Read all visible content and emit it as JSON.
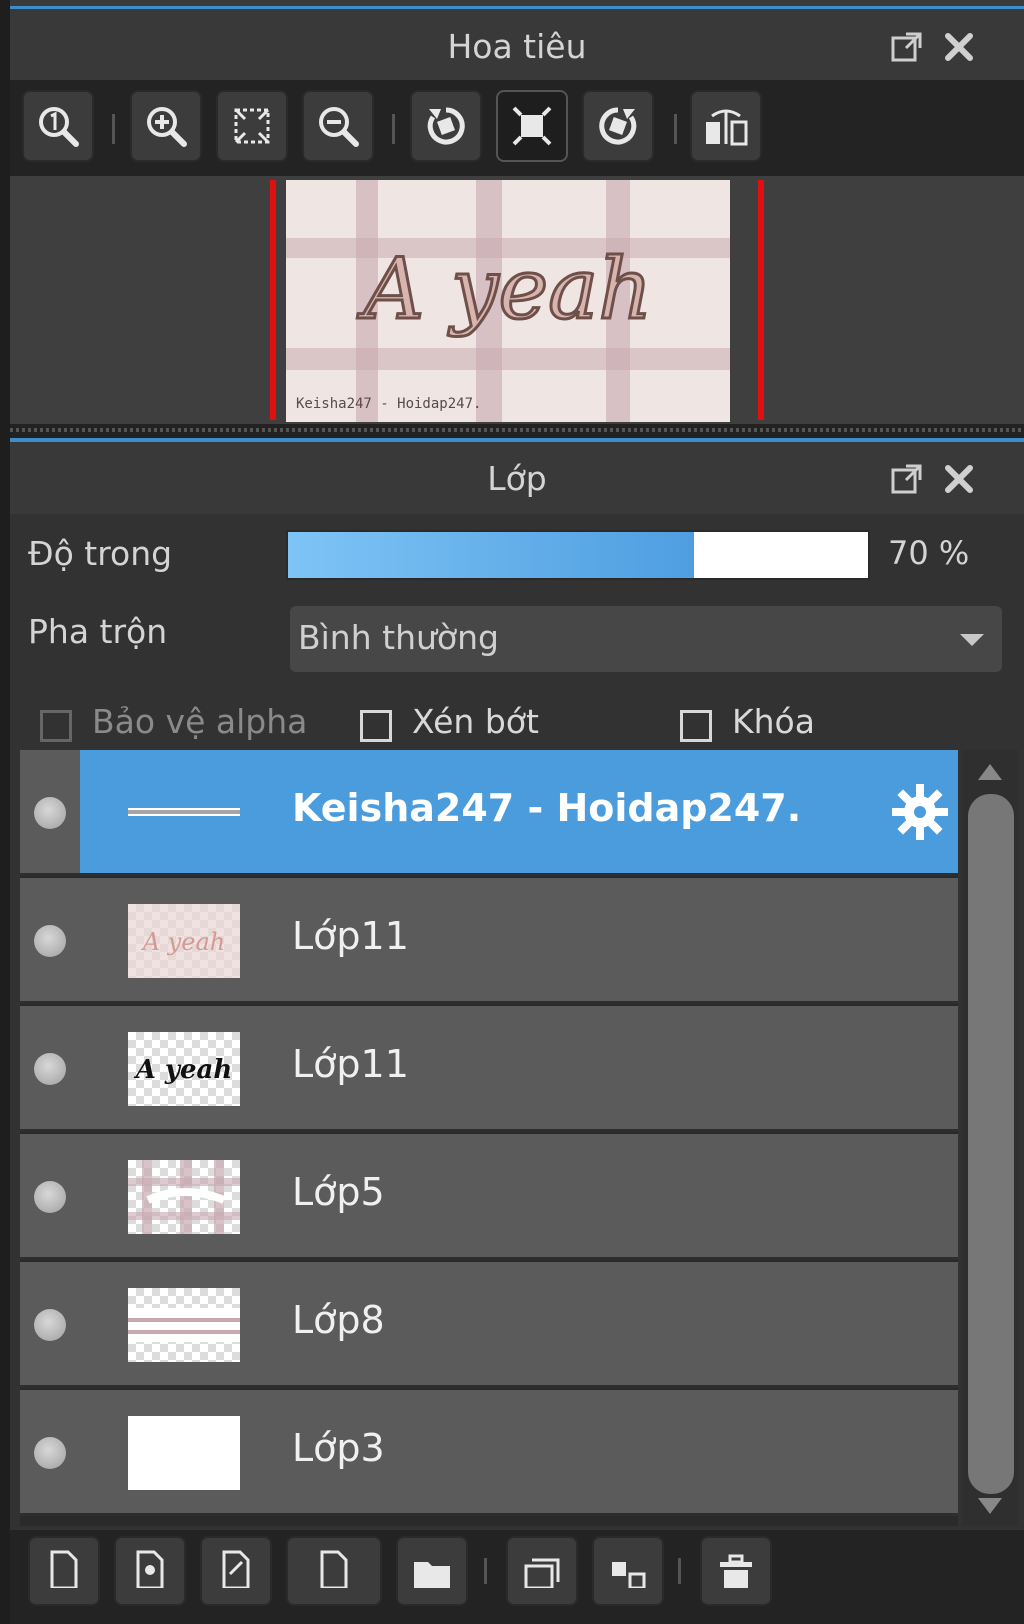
{
  "navigator": {
    "title": "Hoa tiêu",
    "header_icons": [
      "popout-icon",
      "close-icon"
    ],
    "toolbar": [
      "zoom-actual-icon",
      "zoom-in-icon",
      "fit-icon",
      "zoom-out-icon",
      "rotate-left-icon",
      "fit-screen-icon",
      "rotate-right-icon",
      "flip-icon"
    ],
    "preview": {
      "main_text": "A yeah",
      "credit_text": "Keisha247 - Hoidap247."
    }
  },
  "layers": {
    "title": "Lớp",
    "opacity_label": "Độ trong",
    "opacity_value": "70 %",
    "opacity_fraction": 0.7,
    "blend_label": "Pha trộn",
    "blend_value": "Bình thường",
    "checkboxes": {
      "protect_alpha": "Bảo vệ alpha",
      "clipping": "Xén bớt",
      "lock": "Khóa"
    },
    "items": [
      {
        "name": "Keisha247 - Hoidap247.",
        "selected": true,
        "thumb": "line"
      },
      {
        "name": "Lớp11",
        "selected": false,
        "thumb": "pink-text"
      },
      {
        "name": "Lớp11",
        "selected": false,
        "thumb": "black-text"
      },
      {
        "name": "Lớp5",
        "selected": false,
        "thumb": "pattern"
      },
      {
        "name": "Lớp8",
        "selected": false,
        "thumb": "stripe"
      },
      {
        "name": "Lớp3",
        "selected": false,
        "thumb": "white"
      }
    ],
    "colors": {
      "accent": "#3d8ccc",
      "selected_row": "#4b9cdd",
      "row": "#5b5b5b",
      "guide_red": "#e01010"
    }
  }
}
